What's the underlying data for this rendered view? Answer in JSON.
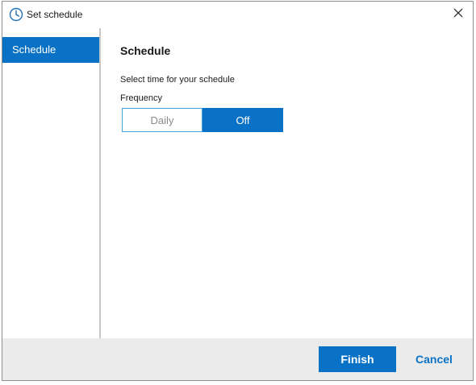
{
  "window": {
    "title": "Set schedule",
    "icon": "clock-icon",
    "close_icon": "close-icon"
  },
  "sidebar": {
    "items": [
      {
        "label": "Schedule",
        "selected": true
      }
    ]
  },
  "main": {
    "title": "Schedule",
    "subtitle": "Select time for your schedule",
    "frequency": {
      "label": "Frequency",
      "options": [
        "Daily",
        "Off"
      ],
      "selected": "Off"
    }
  },
  "footer": {
    "finish_label": "Finish",
    "cancel_label": "Cancel"
  },
  "colors": {
    "accent": "#0a72c6",
    "footer_bg": "#ebebeb",
    "unselected_text": "#8a8a8a"
  }
}
